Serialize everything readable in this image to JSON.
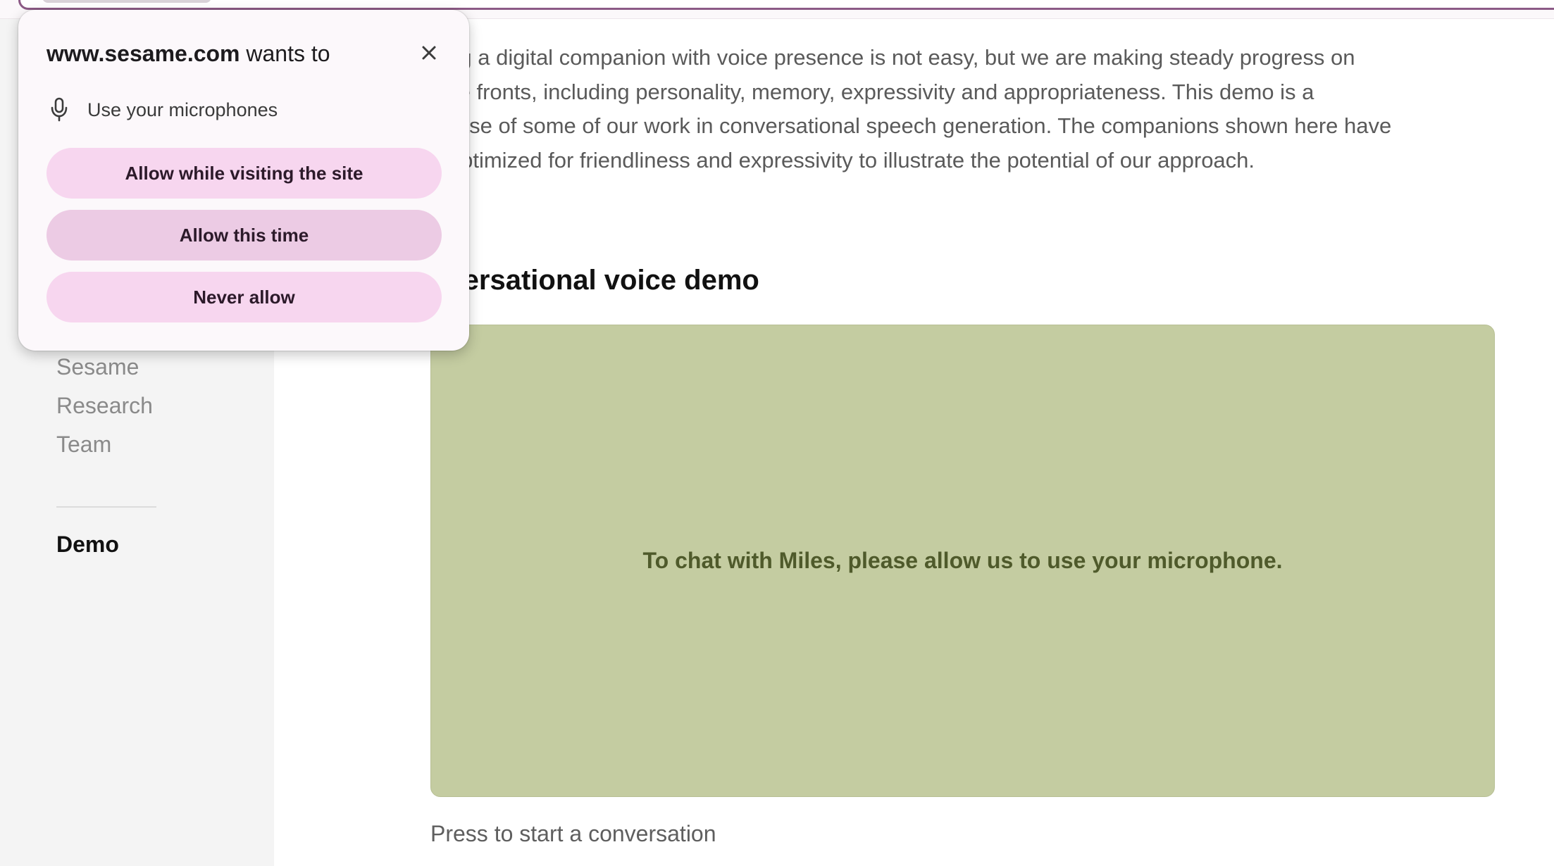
{
  "sidebar": {
    "items": [
      {
        "label": "Sesame"
      },
      {
        "label": "Research"
      },
      {
        "label": "Team"
      }
    ],
    "active_item": "Demo"
  },
  "main": {
    "intro_lines": [
      "ding a digital companion with voice presence is not easy, but we are making steady progress on",
      "tiple fronts, including personality, memory, expressivity and appropriateness. This demo is a",
      "wcase of some of our work in conversational speech generation. The companions shown here have",
      "n optimized for friendliness and expressivity to illustrate the potential of our approach."
    ],
    "section_title": "nversational voice demo",
    "demo_message": "To chat with Miles, please allow us to use your microphone.",
    "press_text": "Press to start a conversation"
  },
  "permission_popup": {
    "site": "www.sesame.com",
    "title_suffix": " wants to",
    "permission_label": "Use your microphones",
    "permission_icon": "microphone-icon",
    "close_icon": "close-icon",
    "buttons": {
      "allow_site": "Allow while visiting the site",
      "allow_once": "Allow this time",
      "never": "Never allow"
    }
  },
  "colors": {
    "demo_panel": "#c4cca1",
    "demo_text": "#4f5a2b",
    "popup_bg": "#fcf8fb",
    "button_pink": "#f7d6ef",
    "button_pink_hover": "#eccbe4",
    "omnibox_border": "#8c5a86"
  }
}
